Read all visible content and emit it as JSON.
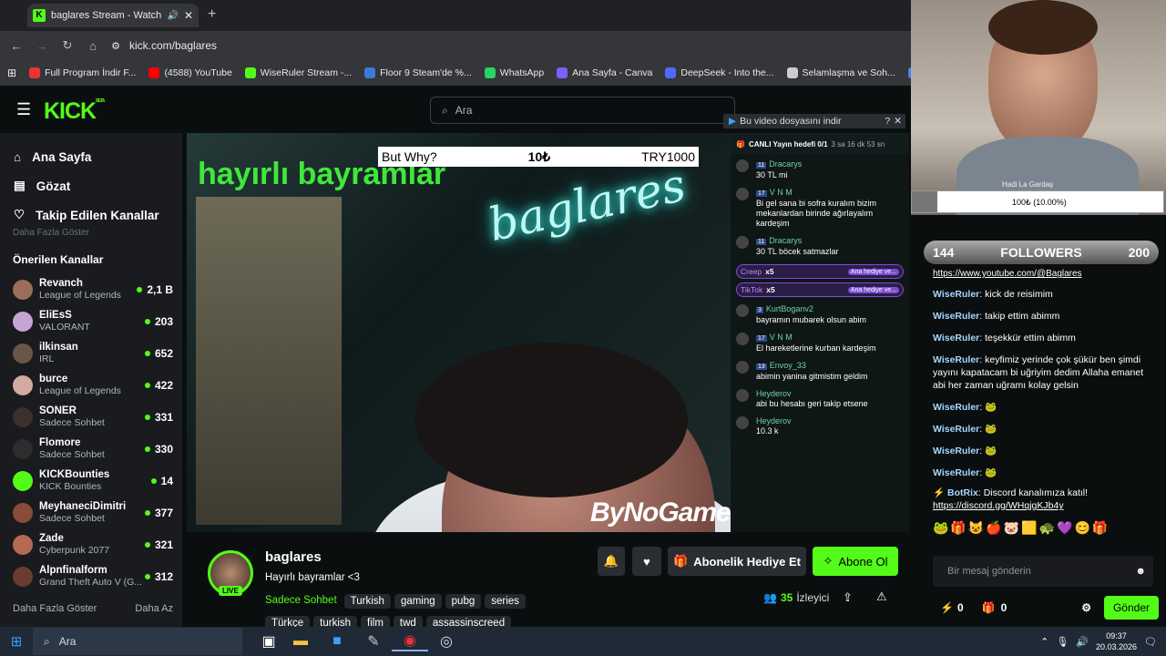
{
  "browser": {
    "tab_title": "baglares Stream - Watch Liv",
    "url": "kick.com/baglares",
    "bookmarks": [
      {
        "label": "Full Program İndir F...",
        "color": "#e33"
      },
      {
        "label": "(4588) YouTube",
        "color": "#f00"
      },
      {
        "label": "WiseRuler Stream -...",
        "color": "#53fc18"
      },
      {
        "label": "Floor 9 Steam'de %...",
        "color": "#3b7bd6"
      },
      {
        "label": "WhatsApp",
        "color": "#25d366"
      },
      {
        "label": "Ana Sayfa - Canva",
        "color": "#7d5fff"
      },
      {
        "label": "DeepSeek - Into the...",
        "color": "#4d6bfe"
      },
      {
        "label": "Selamlaşma ve Soh...",
        "color": "#ccc"
      },
      {
        "label": "Google G",
        "color": "#4285f4"
      }
    ]
  },
  "kick": {
    "logo": "KICK",
    "beta": "BETA",
    "search_placeholder": "Ara",
    "nav": [
      {
        "label": "Ana Sayfa",
        "icon": "home-icon"
      },
      {
        "label": "Gözat",
        "icon": "browse-icon"
      },
      {
        "label": "Takip Edilen Kanallar",
        "icon": "heart-icon"
      }
    ],
    "show_more_top": "Daha Fazla Göster",
    "recommended_title": "Önerilen Kanallar",
    "channels": [
      {
        "name": "Revanch",
        "category": "League of Legends",
        "viewers": "2,1 B"
      },
      {
        "name": "EliEsS",
        "category": "VALORANT",
        "viewers": "203"
      },
      {
        "name": "ilkinsan",
        "category": "IRL",
        "viewers": "652"
      },
      {
        "name": "burce",
        "category": "League of Legends",
        "viewers": "422"
      },
      {
        "name": "SONER",
        "category": "Sadece Sohbet",
        "viewers": "331"
      },
      {
        "name": "Flomore",
        "category": "Sadece Sohbet",
        "viewers": "330"
      },
      {
        "name": "KICKBounties",
        "category": "KICK Bounties",
        "viewers": "14"
      },
      {
        "name": "MeyhaneciDimitri",
        "category": "Sadece Sohbet",
        "viewers": "377"
      },
      {
        "name": "Zade",
        "category": "Cyberpunk 2077",
        "viewers": "321"
      },
      {
        "name": "Alpnfinalform",
        "category": "Grand Theft Auto V (G...",
        "viewers": "312"
      }
    ],
    "show_more": "Daha Fazla Göster",
    "show_less": "Daha Az"
  },
  "video": {
    "overlay_title": "hayırlı bayramlar",
    "neon": "baglares",
    "goal_label": "But Why?",
    "goal_value": "10₺",
    "goal_target": "TRY1000",
    "brand": "ByNoGame",
    "report_banner": "Bu video dosyasını indir",
    "live_goal": "CANLI Yayın hedefi 0/1",
    "live_goal_time": "3 sa 16 dk 53 sn",
    "chat": [
      {
        "user": "Dracarys",
        "badge": "11",
        "text": "30 TL mi"
      },
      {
        "user": "V N M",
        "badge": "17",
        "text": "Bi gel sana bi sofra kuralım bizim mekanlardan birinde ağırlayalım kardeşim"
      },
      {
        "user": "Dracarys",
        "badge": "11",
        "text": "30 TL böcek satmazlar"
      },
      {
        "user": "KurtBoganv2",
        "badge": "3",
        "text": "bayramın mubarek olsun abim"
      },
      {
        "user": "V N M",
        "badge": "17",
        "text": "El hareketlerine kurban kardeşim"
      },
      {
        "user": "Envoy_33",
        "badge": "13",
        "text": "abimin yanina gitmistim geldim"
      },
      {
        "user": "Heyderov",
        "badge": "",
        "text": "abi bu hesabı geri takip etsene"
      },
      {
        "user": "Heyderov",
        "badge": "",
        "text": "10.3 k"
      }
    ],
    "gift1": "Creep",
    "gift2": "TikTok",
    "gift_mult": "x5",
    "gift_tag": "Ana hediye ve..."
  },
  "streamer": {
    "name": "baglares",
    "title": "Hayırlı bayramlar <3",
    "live": "LIVE",
    "category": "Sadece Sohbet",
    "tags": [
      "Turkish",
      "gaming",
      "pubg",
      "series"
    ],
    "tags2": [
      "Türkçe",
      "turkish",
      "film",
      "twd",
      "assassinscreed"
    ],
    "viewers": "35",
    "viewers_label": "İzleyici",
    "gift_sub": "Abonelik Hediye Et",
    "subscribe": "Abone Ol"
  },
  "cam": {
    "goal_text": "Hadi La Gardaş",
    "goal_progress": "100₺ (10.00%)",
    "goal_fraction": 0.1,
    "followers_current": "144",
    "followers_label": "FOLLOWERS",
    "followers_target": "200"
  },
  "rchat": {
    "messages": [
      {
        "user": "WiseRuler",
        "text": "kick de reisimim"
      },
      {
        "user": "WiseRuler",
        "text": "takip ettim abimm"
      },
      {
        "user": "WiseRuler",
        "text": "teşekkür ettim abimm"
      },
      {
        "user": "WiseRuler",
        "text": "keyfimiz yerinde çok şükür ben şimdi yayını kapatacam bi uğriyim dedim Allaha emanet abi her zaman uğramı kolay gelsin"
      },
      {
        "user": "WiseRuler",
        "text": "🐸"
      },
      {
        "user": "WiseRuler",
        "text": "🐸"
      },
      {
        "user": "WiseRuler",
        "text": "🐸"
      },
      {
        "user": "WiseRuler",
        "text": "🐸"
      }
    ],
    "top_user": "WiseRuler",
    "top_link": "https://www.youtube.com/@Baglares",
    "bot_user": "BotRix",
    "bot_text": "Discord kanalımıza katıl!",
    "bot_link": "https://discord.gg/WHqjgKJb4y",
    "input_placeholder": "Bir mesaj gönderin",
    "count1": "0",
    "count2": "0",
    "send": "Gönder"
  },
  "taskbar": {
    "search": "Ara",
    "time": "09:37",
    "date": "20.03.2026"
  }
}
